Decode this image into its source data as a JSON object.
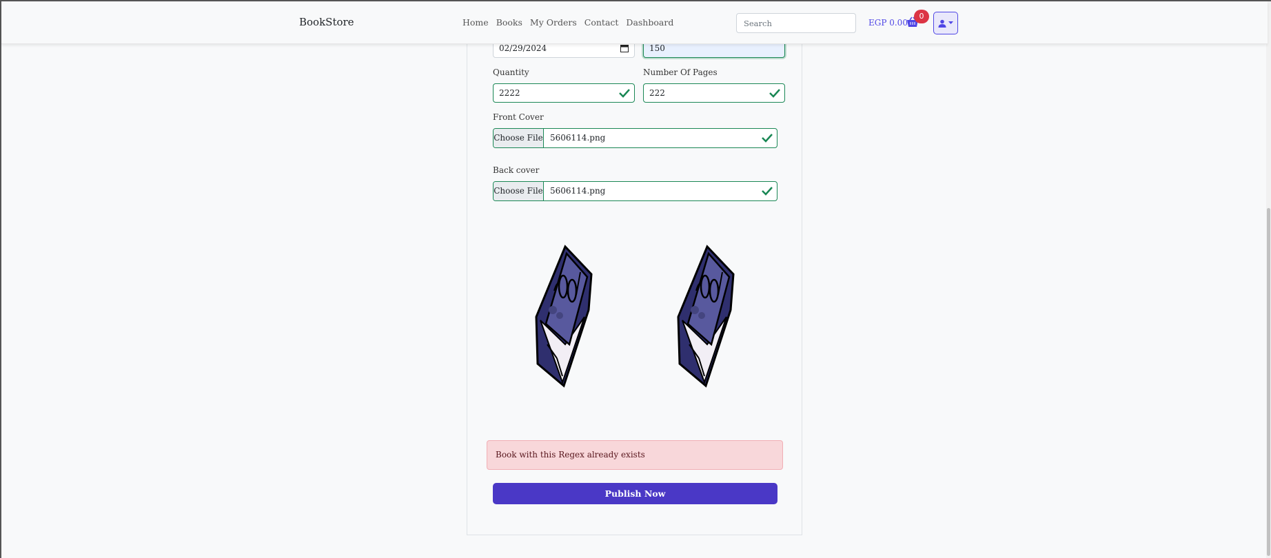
{
  "nav": {
    "brand": "BookStore",
    "links": [
      "Home",
      "Books",
      "My Orders",
      "Contact",
      "Dashboard"
    ],
    "search_placeholder": "Search",
    "balance": "EGP 0.00",
    "cart_count": "0"
  },
  "form": {
    "date_value": "02/29/2024",
    "price_value": "150",
    "quantity_label": "Quantity",
    "quantity_value": "2222",
    "pages_label": "Number Of Pages",
    "pages_value": "222",
    "front_label": "Front Cover",
    "front_button": "Choose File",
    "front_file": "5606114.png",
    "back_label": "Back cover",
    "back_button": "Choose File",
    "back_file": "5606114.png"
  },
  "alert": {
    "message": "Book with this Regex already exists"
  },
  "publish_label": "Publish Now",
  "colors": {
    "accent": "#4a38c6",
    "valid": "#198754",
    "alert_bg": "#f8d7da",
    "badge": "#dc3545"
  }
}
